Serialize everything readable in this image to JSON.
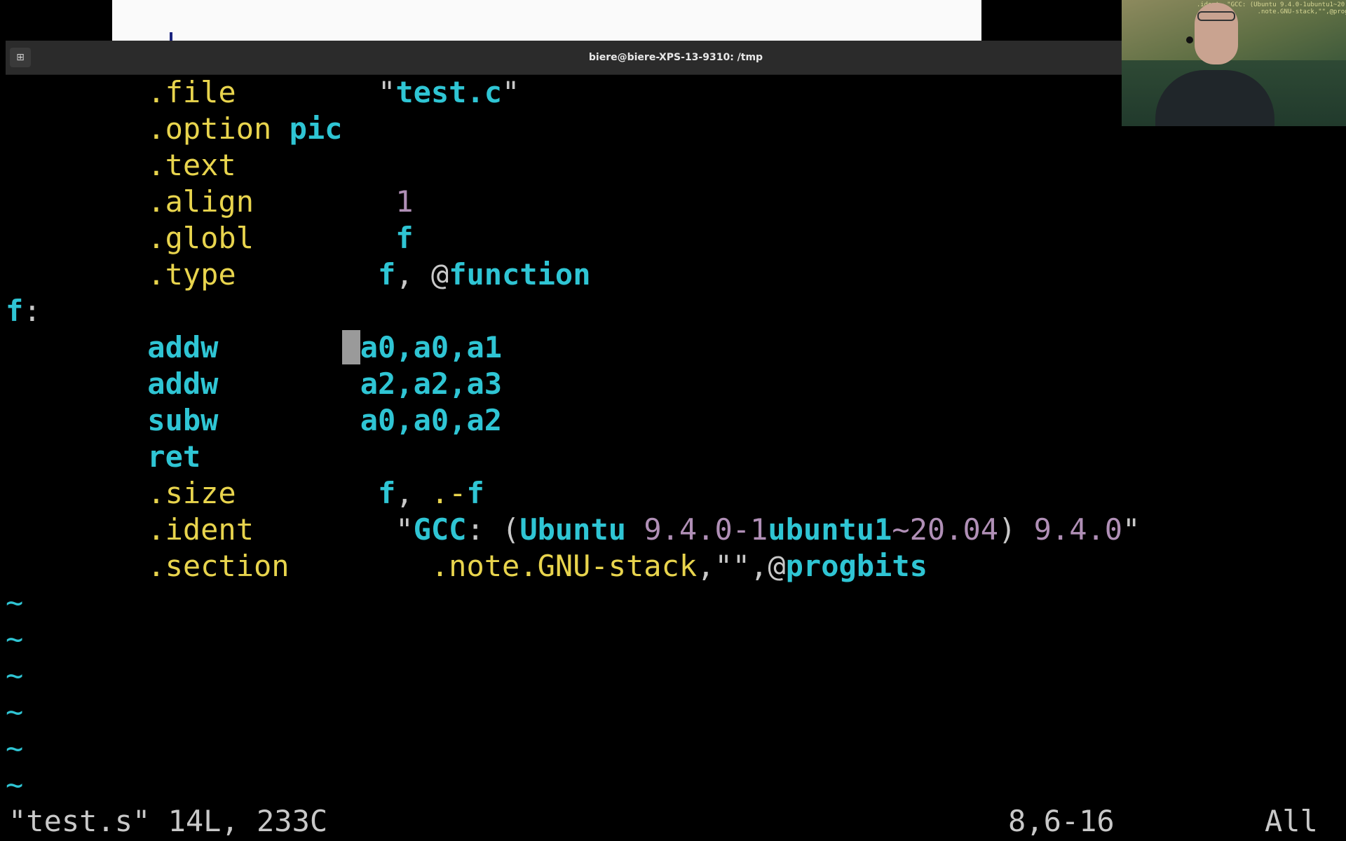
{
  "window": {
    "title": "biere@biere-XPS-13-9310: /tmp",
    "new_tab_icon": "new-tab-icon"
  },
  "editor": {
    "lines": [
      [
        {
          "t": "\t.file\t",
          "cls": "y"
        },
        {
          "t": "\"",
          "cls": "w"
        },
        {
          "t": "test.c",
          "cls": "cb"
        },
        {
          "t": "\"",
          "cls": "w"
        }
      ],
      [
        {
          "t": "\t.option ",
          "cls": "y"
        },
        {
          "t": "pic",
          "cls": "cb"
        }
      ],
      [
        {
          "t": "\t.text",
          "cls": "y"
        }
      ],
      [
        {
          "t": "\t.align\t",
          "cls": "y"
        },
        {
          "t": "1",
          "cls": "m"
        }
      ],
      [
        {
          "t": "\t.globl\t",
          "cls": "y"
        },
        {
          "t": "f",
          "cls": "cb"
        }
      ],
      [
        {
          "t": "\t.type\t",
          "cls": "y"
        },
        {
          "t": "f",
          "cls": "cb"
        },
        {
          "t": ", ",
          "cls": "w"
        },
        {
          "t": "@",
          "cls": "w"
        },
        {
          "t": "function",
          "cls": "cb"
        }
      ],
      [
        {
          "t": "f",
          "cls": "cb"
        },
        {
          "t": ":",
          "cls": "w"
        }
      ],
      [
        {
          "t": "\taddw\t",
          "cls": "cb"
        },
        {
          "t": "a0,a0,a1",
          "cls": "cb"
        }
      ],
      [
        {
          "t": "\taddw\t",
          "cls": "cb"
        },
        {
          "t": "a2,a2,a3",
          "cls": "cb"
        }
      ],
      [
        {
          "t": "\tsubw\t",
          "cls": "cb"
        },
        {
          "t": "a0,a0,a2",
          "cls": "cb"
        }
      ],
      [
        {
          "t": "\tret",
          "cls": "cb"
        }
      ],
      [
        {
          "t": "\t.size\t",
          "cls": "y"
        },
        {
          "t": "f",
          "cls": "cb"
        },
        {
          "t": ", ",
          "cls": "w"
        },
        {
          "t": ".-",
          "cls": "y"
        },
        {
          "t": "f",
          "cls": "cb"
        }
      ],
      [
        {
          "t": "\t.ident\t",
          "cls": "y"
        },
        {
          "t": "\"",
          "cls": "w"
        },
        {
          "t": "GCC",
          "cls": "cb"
        },
        {
          "t": ": (",
          "cls": "w"
        },
        {
          "t": "Ubuntu",
          "cls": "cb"
        },
        {
          "t": " ",
          "cls": "w"
        },
        {
          "t": "9.4.0-1",
          "cls": "m"
        },
        {
          "t": "ubuntu1",
          "cls": "cb"
        },
        {
          "t": "~20.04",
          "cls": "m"
        },
        {
          "t": ") ",
          "cls": "w"
        },
        {
          "t": "9.4.0",
          "cls": "m"
        },
        {
          "t": "\"",
          "cls": "w"
        }
      ],
      [
        {
          "t": "\t.section\t",
          "cls": "y"
        },
        {
          "t": ".note.GNU-stack",
          "cls": "y"
        },
        {
          "t": ",\"\",",
          "cls": "w"
        },
        {
          "t": "@",
          "cls": "w"
        },
        {
          "t": "progbits",
          "cls": "cb"
        }
      ]
    ],
    "tildes": [
      "~",
      "~",
      "~",
      "~",
      "~",
      "~"
    ]
  },
  "status": {
    "file_info": "\"test.s\" 14L, 233C",
    "position": "8,6-16",
    "scroll": "All"
  },
  "colors": {
    "yellow": "#e8d44d",
    "cyan": "#2fc5d4",
    "magenta": "#b08fb6",
    "white": "#c8c8c8"
  }
}
